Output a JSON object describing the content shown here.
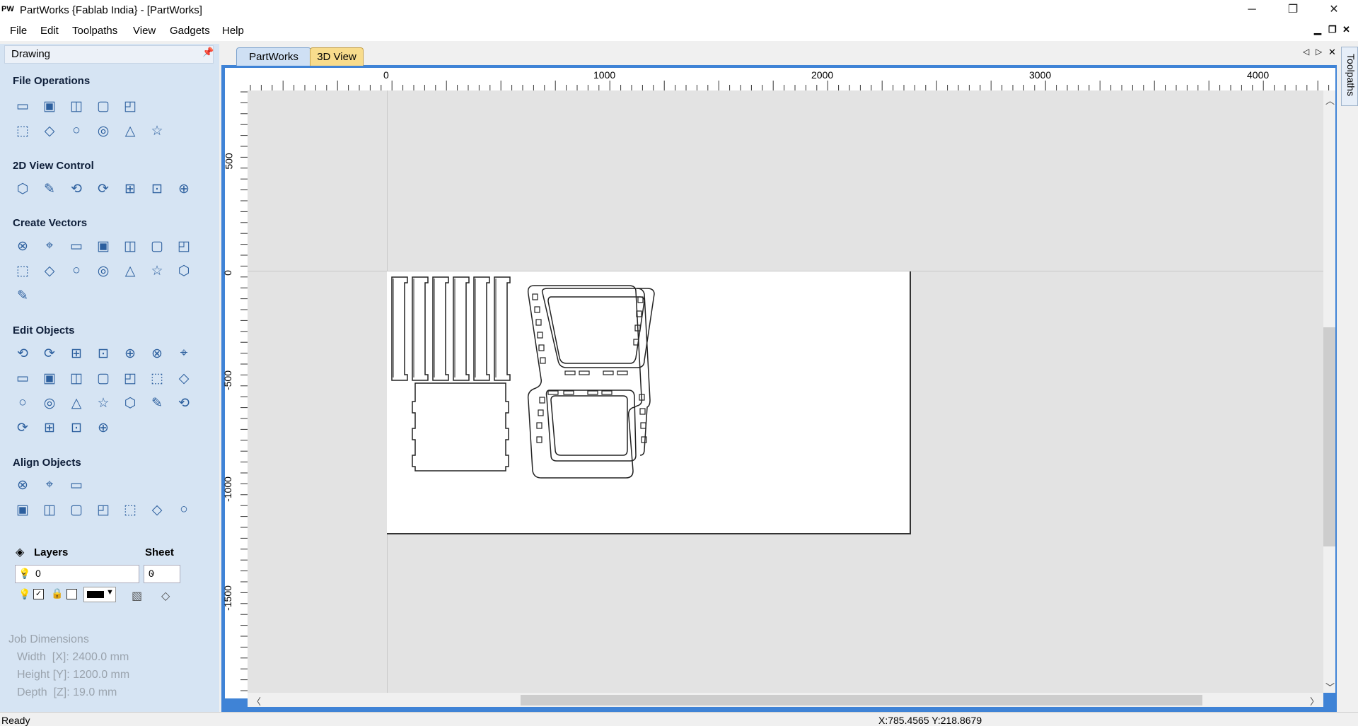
{
  "window": {
    "app_icon": "PW",
    "title": "PartWorks {Fablab India} - [PartWorks]",
    "controls": {
      "minimize": "─",
      "restore": "❐",
      "close": "✕"
    }
  },
  "menu": [
    "File",
    "Edit",
    "Toolpaths",
    "View",
    "Gadgets",
    "Help"
  ],
  "mdi_controls": {
    "minimize": "▁",
    "restore": "❐",
    "close": "✕"
  },
  "panel": {
    "title": "Drawing",
    "sections": {
      "file_ops": "File Operations",
      "view_control": "2D View Control",
      "create_vectors": "Create Vectors",
      "edit_objects": "Edit Objects",
      "align_objects": "Align Objects"
    },
    "icons": {
      "file_ops": [
        "new-file-icon",
        "open-file-icon",
        "save-file-icon",
        "open-folder-icon",
        "import-icon",
        "select-all-icon",
        "cut-icon",
        "copy-icon",
        "paste-icon",
        "undo-icon",
        "redo-icon"
      ],
      "view_control": [
        "pan-icon",
        "zoom-in-icon",
        "zoom-extents-icon",
        "zoom-box-icon",
        "view-toggle-icon",
        "grid-icon",
        "import-view-icon"
      ],
      "create_vectors": [
        "circle-icon",
        "ellipse-icon",
        "rectangle-icon",
        "polyline-icon",
        "line-icon",
        "curve-icon",
        "polygon-icon",
        "star-icon",
        "text-icon",
        "text-box-icon",
        "text-on-curve-icon",
        "text-frame-icon",
        "text-arc-icon",
        "array-icon",
        "node-edit-icon"
      ],
      "edit_objects": [
        "select-icon",
        "node-select-icon",
        "move-select-icon",
        "group-icon",
        "ungroup-icon",
        "measure-icon",
        "transform-icon",
        "scale-icon",
        "resize-icon",
        "center-icon",
        "mirror-icon",
        "array-copy-icon",
        "join-icon",
        "weld-icon",
        "trim-icon",
        "boolean-union-icon",
        "fillet-icon",
        "offset-icon",
        "close-vector-icon",
        "extend-icon",
        "slice-icon",
        "scissors-icon",
        "smooth-icon",
        "arc-fit-icon",
        "bezier-icon",
        "tangent-icon"
      ],
      "align_objects": [
        "align-center-icon",
        "align-h-center-icon",
        "align-v-center-icon",
        "align-page-icon",
        "align-left-icon",
        "align-right-icon",
        "align-top-icon",
        "align-bottom-icon",
        "distribute-h-icon",
        "distribute-v-icon"
      ]
    },
    "layers": {
      "label": "Layers",
      "sheet_label": "Sheet",
      "layer_value": "0",
      "sheet_value": "0"
    },
    "job_dimensions": {
      "title": "Job Dimensions",
      "width": "Width  [X]: 2400.0 mm",
      "height": "Height [Y]: 1200.0 mm",
      "depth": "Depth  [Z]: 19.0 mm"
    }
  },
  "tabs": [
    "PartWorks",
    "3D View"
  ],
  "ruler": {
    "top_labels": [
      "0",
      "1000",
      "2000",
      "3000",
      "4000"
    ],
    "left_labels": [
      "500",
      "0",
      "-500",
      "-1000",
      "-1500"
    ]
  },
  "right_strip": {
    "label": "Toolpaths"
  },
  "status": {
    "text": "Ready",
    "coords": "X:785.4565 Y:218.8679"
  },
  "colors": {
    "panel": "#d6e4f3",
    "tab_active": "#cfe0f4",
    "tab_inactive": "#f8dc8c",
    "frame": "#3f83d6"
  }
}
